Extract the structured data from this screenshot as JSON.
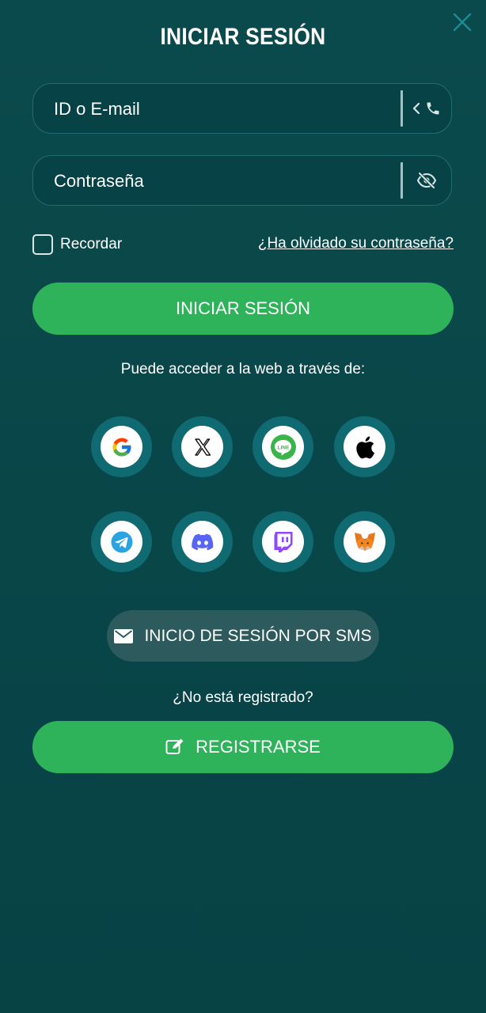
{
  "title": "INICIAR SESIÓN",
  "close_icon": "close-icon",
  "login_form": {
    "id_field": {
      "placeholder": "ID o E-mail",
      "icons": [
        "chevron-left-icon",
        "phone-icon"
      ]
    },
    "password_field": {
      "placeholder": "Contraseña",
      "icons": [
        "eye-slash-icon"
      ]
    },
    "remember_label": "Recordar",
    "forgot_link": "¿Ha olvidado su contraseña?",
    "submit_label": "INICIAR SESIÓN"
  },
  "social_login": {
    "caption": "Puede acceder a la web a través de:",
    "providers": [
      {
        "name": "Google",
        "icon": "google-icon"
      },
      {
        "name": "X",
        "icon": "x-icon"
      },
      {
        "name": "LINE",
        "icon": "line-icon",
        "badge_text": "LINE"
      },
      {
        "name": "Apple",
        "icon": "apple-icon"
      },
      {
        "name": "Telegram",
        "icon": "telegram-icon"
      },
      {
        "name": "Discord",
        "icon": "discord-icon"
      },
      {
        "name": "Twitch",
        "icon": "twitch-icon"
      },
      {
        "name": "MetaMask",
        "icon": "metamask-icon"
      }
    ]
  },
  "sms_login": {
    "label": "INICIO DE SESIÓN POR SMS",
    "icon": "envelope-icon"
  },
  "register": {
    "prompt": "¿No está registrado?",
    "label": "REGISTRARSE",
    "icon": "edit-icon"
  },
  "colors": {
    "background": "#0a4a4c",
    "primary_green": "#2fb35a",
    "social_ring": "#0f6a72",
    "sms_button": "#2d5a5d",
    "field_border": "#1f6e74"
  }
}
